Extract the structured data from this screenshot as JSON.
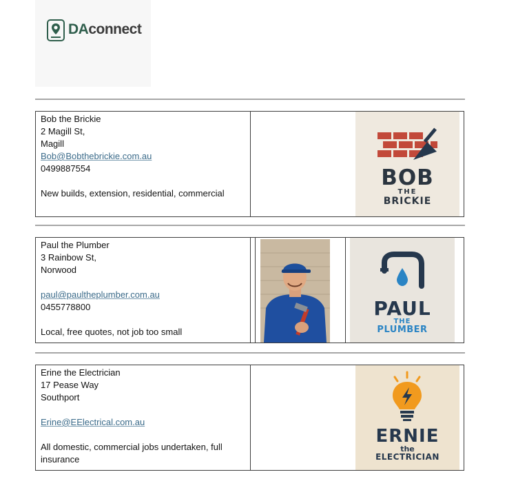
{
  "header": {
    "brand_prefix": "DA",
    "brand_suffix": "connect"
  },
  "listings": [
    {
      "name": "Bob the Brickie",
      "address_line1": "2 Magill St,",
      "address_line2": "Magill",
      "email": "Bob@Bobthebrickie.com.au",
      "phone": "0499887554",
      "description": "New builds, extension, residential, commercial",
      "logo": {
        "big": "BOB",
        "small1": "THE",
        "small2": "BRICKIE",
        "icon": "brick-trowel-icon"
      }
    },
    {
      "name": "Paul the Plumber",
      "address_line1": "3 Rainbow St,",
      "address_line2": "Norwood",
      "email": "paul@paultheplumber.com.au",
      "phone": "0455778800",
      "description": "Local, free quotes, not job too small",
      "logo": {
        "big": "PAUL",
        "small1": "THE",
        "small2": "PLUMBER",
        "icon": "pipe-drop-icon"
      },
      "photo": "plumber-portrait-photo"
    },
    {
      "name": "Erine the Electrician",
      "address_line1": "17 Pease Way",
      "address_line2": "Southport",
      "email": "Erine@EElectrical.com.au",
      "description": "All domestic, commercial jobs undertaken, full insurance",
      "logo": {
        "big": "ERNIE",
        "small1": "the",
        "small2": "ELECTRICIAN",
        "icon": "lightbulb-bolt-icon"
      }
    }
  ],
  "colors": {
    "brand_green": "#2f5e4c",
    "link": "#3b6b8a",
    "brick_red": "#c2493a",
    "navy": "#26384d",
    "plumber_blue": "#2a84c4",
    "bulb_orange": "#f19a1e"
  }
}
